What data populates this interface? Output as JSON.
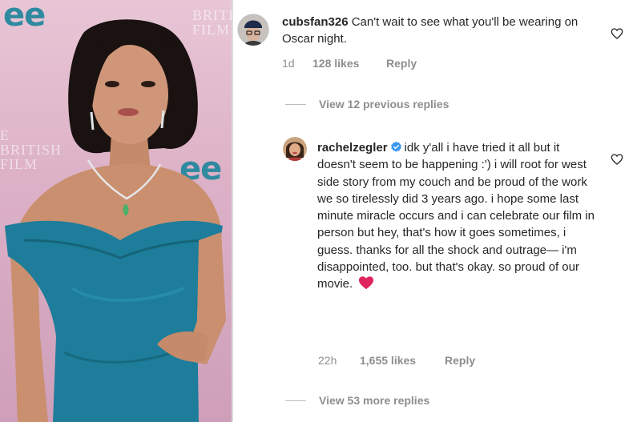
{
  "photo": {
    "backdrop_logo": "ee",
    "backdrop_text_top": "BRITISH\nFILM A",
    "backdrop_text_mid": "E\nBRITISH\nFILM"
  },
  "comment1": {
    "username": "cubsfan326",
    "text": "Can't wait to see what you'll be wearing on Oscar night.",
    "time": "1d",
    "likes": "128 likes",
    "reply": "Reply"
  },
  "view_previous": "View 12 previous replies",
  "comment2": {
    "username": "rachelzegler",
    "text": "idk y'all i have tried it all but it doesn't seem to be happening :') i will root for west side story from my couch and be proud of the work we so tirelessly did 3 years ago. i hope some last minute miracle occurs and i can celebrate our film in person but hey, that's how it goes sometimes, i guess. thanks for all the shock and outrage— i'm disappointed, too. but that's okay. so proud of our movie.",
    "emoji": "❤️",
    "time": "22h",
    "likes": "1,655 likes",
    "reply": "Reply"
  },
  "view_more": "View 53 more replies",
  "colors": {
    "dress": "#1d7d9a",
    "backdrop": "#dcb0c6",
    "meta_gray": "#8e8e8e",
    "verified_blue": "#3897f0",
    "emoji_red": "#e0245e"
  }
}
